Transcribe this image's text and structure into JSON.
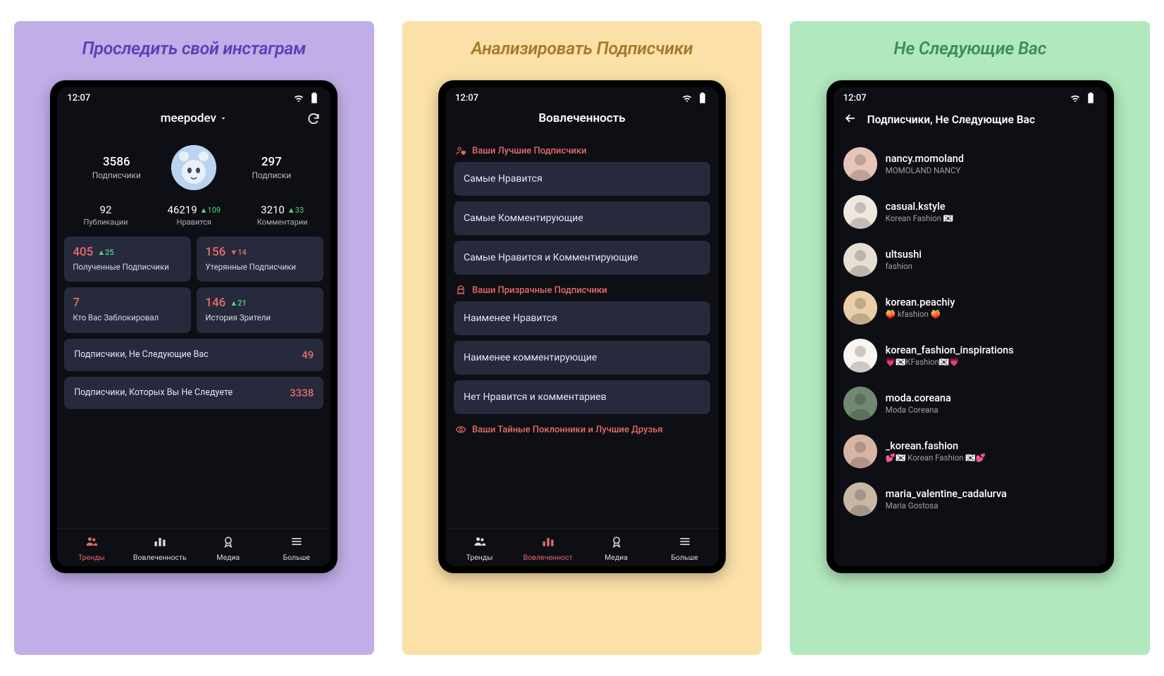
{
  "status_time": "12:07",
  "panels": [
    {
      "title": "Проследить свой инстаграм"
    },
    {
      "title": "Анализировать Подписчики"
    },
    {
      "title": "Не Следующие Вас"
    }
  ],
  "p1": {
    "username": "meepodev",
    "followers": {
      "value": "3586",
      "label": "Подписчики"
    },
    "following": {
      "value": "297",
      "label": "Подписки"
    },
    "posts": {
      "value": "92",
      "label": "Публикации"
    },
    "likes": {
      "value": "46219",
      "delta": "▲109",
      "label": "Нравится"
    },
    "comments": {
      "value": "3210",
      "delta": "▲33",
      "label": "Комментарии"
    },
    "cards": {
      "gained": {
        "value": "405",
        "delta": "▲25",
        "label": "Полученные Подписчики"
      },
      "lost": {
        "value": "156",
        "delta": "▼14",
        "label": "Утерянные Подписчики"
      },
      "blocked": {
        "value": "7",
        "label": "Кто Вас Заблокировал"
      },
      "story": {
        "value": "146",
        "delta": "▲21",
        "label": "История Зрители"
      }
    },
    "rows": [
      {
        "label": "Подписчики, Не Следующие Вас",
        "value": "49"
      },
      {
        "label": "Подписчики, Которых Вы Не Следуете",
        "value": "3338"
      }
    ]
  },
  "p2": {
    "header": "Вовлеченность",
    "sections": [
      {
        "title": "Ваши Лучшие Подписчики",
        "icon": "user-heart",
        "items": [
          "Самые Нравится",
          "Самые Комментирующие",
          "Самые Нравится и Комментирующие"
        ]
      },
      {
        "title": "Ваши Призрачные Подписчики",
        "icon": "ghost",
        "items": [
          "Наименее Нравится",
          "Наименее комментирующие",
          "Нет Нравится и комментариев"
        ]
      },
      {
        "title": "Ваши Тайные Поклонники и Лучшие Друзья",
        "icon": "eye",
        "items": []
      }
    ]
  },
  "p3": {
    "header": "Подписчики, Не Следующие Вас",
    "users": [
      {
        "name": "nancy.momoland",
        "desc": "MOMOLAND NANCY",
        "bg": "#e8c4b8"
      },
      {
        "name": "casual.kstyle",
        "desc": "Korean Fashion 🇰🇷",
        "bg": "#efe8df"
      },
      {
        "name": "ultsushi",
        "desc": "fashion",
        "bg": "#e6dfd2"
      },
      {
        "name": "korean.peachiy",
        "desc": "🍑 kfashion 🍑",
        "bg": "#e9cfa8"
      },
      {
        "name": "korean_fashion_inspirations",
        "desc": "💗🇰🇷KFashion🇰🇷💗",
        "bg": "#faf5f1"
      },
      {
        "name": "moda.coreana",
        "desc": "Moda Coreana",
        "bg": "#6f8a70"
      },
      {
        "name": "_korean.fashion",
        "desc": "💕🇰🇷 Korean Fashion 🇰🇷💕",
        "bg": "#d8b4a6"
      },
      {
        "name": "maria_valentine_cadalurva",
        "desc": "Maria Gostosa",
        "bg": "#c9b6a4"
      }
    ]
  },
  "nav": {
    "trends": "Тренды",
    "engagement_short": "Вовлеченност",
    "engagement": "Вовлеченность",
    "media": "Медиа",
    "more": "Больше"
  }
}
